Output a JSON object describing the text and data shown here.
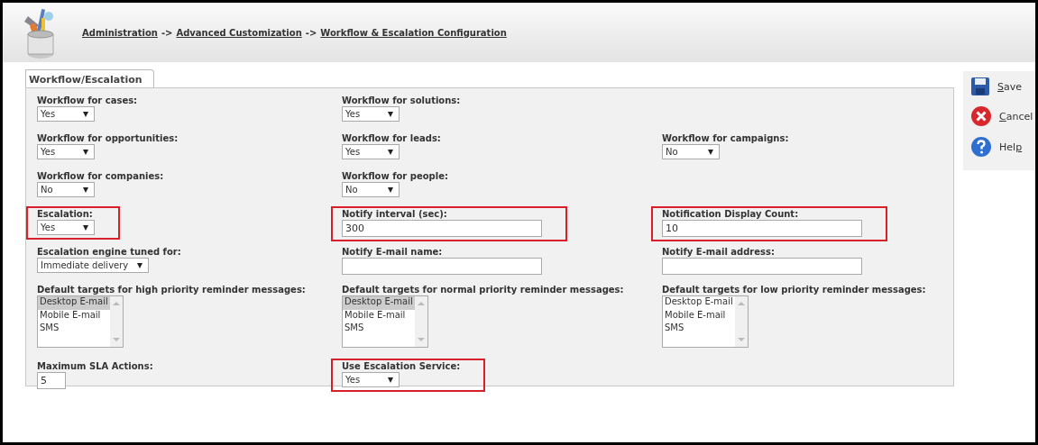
{
  "breadcrumb": [
    {
      "kind": "link",
      "text": "Administration"
    },
    {
      "kind": "separator",
      "text": "->"
    },
    {
      "kind": "link",
      "text": "Advanced Customization"
    },
    {
      "kind": "separator",
      "text": "->"
    },
    {
      "kind": "link",
      "text": "Workflow & Escalation Configuration"
    }
  ],
  "tabs": [
    {
      "label": "Workflow/Escalation"
    }
  ],
  "rows": [
    {
      "cells": [
        {
          "kind": "select",
          "label": "Workflow for cases:",
          "value": "Yes",
          "highlighted": false
        },
        {
          "kind": "select",
          "label": "Workflow for solutions:",
          "value": "Yes",
          "highlighted": false
        },
        {
          "kind": "empty"
        }
      ]
    },
    {
      "cells": [
        {
          "kind": "select",
          "label": "Workflow for opportunities:",
          "value": "Yes",
          "highlighted": false
        },
        {
          "kind": "select",
          "label": "Workflow for leads:",
          "value": "Yes",
          "highlighted": false
        },
        {
          "kind": "select",
          "label": "Workflow for campaigns:",
          "value": "No",
          "highlighted": false
        }
      ]
    },
    {
      "cells": [
        {
          "kind": "select",
          "label": "Workflow for companies:",
          "value": "No",
          "highlighted": false
        },
        {
          "kind": "select",
          "label": "Workflow for people:",
          "value": "No",
          "highlighted": false
        },
        {
          "kind": "empty"
        }
      ]
    },
    {
      "cells": [
        {
          "kind": "select",
          "label": "Escalation:",
          "value": "Yes",
          "highlighted": true
        },
        {
          "kind": "text",
          "label": "Notify interval (sec):",
          "value": "300",
          "highlighted": true
        },
        {
          "kind": "text",
          "label": "Notification Display Count:",
          "value": "10",
          "highlighted": true
        }
      ]
    },
    {
      "cells": [
        {
          "kind": "wideselect",
          "label": "Escalation engine tuned for:",
          "value": "Immediate delivery",
          "highlighted": false
        },
        {
          "kind": "text",
          "label": "Notify E-mail name:",
          "highlighted": false
        },
        {
          "kind": "text",
          "label": "Notify E-mail address:",
          "highlighted": false
        }
      ]
    },
    {
      "cells": [
        {
          "kind": "listbox",
          "label": "Default targets for high priority reminder messages:",
          "highlighted": false,
          "options": [
            {
              "text": "Desktop E-mail",
              "selected": true
            },
            {
              "text": "Mobile E-mail",
              "selected": false
            },
            {
              "text": "SMS",
              "selected": false
            }
          ]
        },
        {
          "kind": "listbox",
          "label": "Default targets for normal priority reminder messages:",
          "highlighted": false,
          "options": [
            {
              "text": "Desktop E-mail",
              "selected": true
            },
            {
              "text": "Mobile E-mail",
              "selected": false
            },
            {
              "text": "SMS",
              "selected": false
            }
          ]
        },
        {
          "kind": "listbox",
          "label": "Default targets for low priority reminder messages:",
          "highlighted": false,
          "options": [
            {
              "text": "Desktop E-mail",
              "selected": false
            },
            {
              "text": "Mobile E-mail",
              "selected": false
            },
            {
              "text": "SMS",
              "selected": false
            }
          ]
        }
      ]
    },
    {
      "cells": [
        {
          "kind": "smalltext",
          "label": "Maximum SLA Actions:",
          "value": "5",
          "highlighted": false
        },
        {
          "kind": "select",
          "label": "Use Escalation Service:",
          "value": "Yes",
          "highlighted": true
        },
        {
          "kind": "empty"
        }
      ]
    }
  ],
  "actions": [
    {
      "kind": "save",
      "mnemonic": "S",
      "after": "ave"
    },
    {
      "kind": "cancel",
      "mnemonic": "C",
      "after": "ancel"
    },
    {
      "kind": "help",
      "before": "Hel",
      "mnemonic": "p"
    }
  ]
}
